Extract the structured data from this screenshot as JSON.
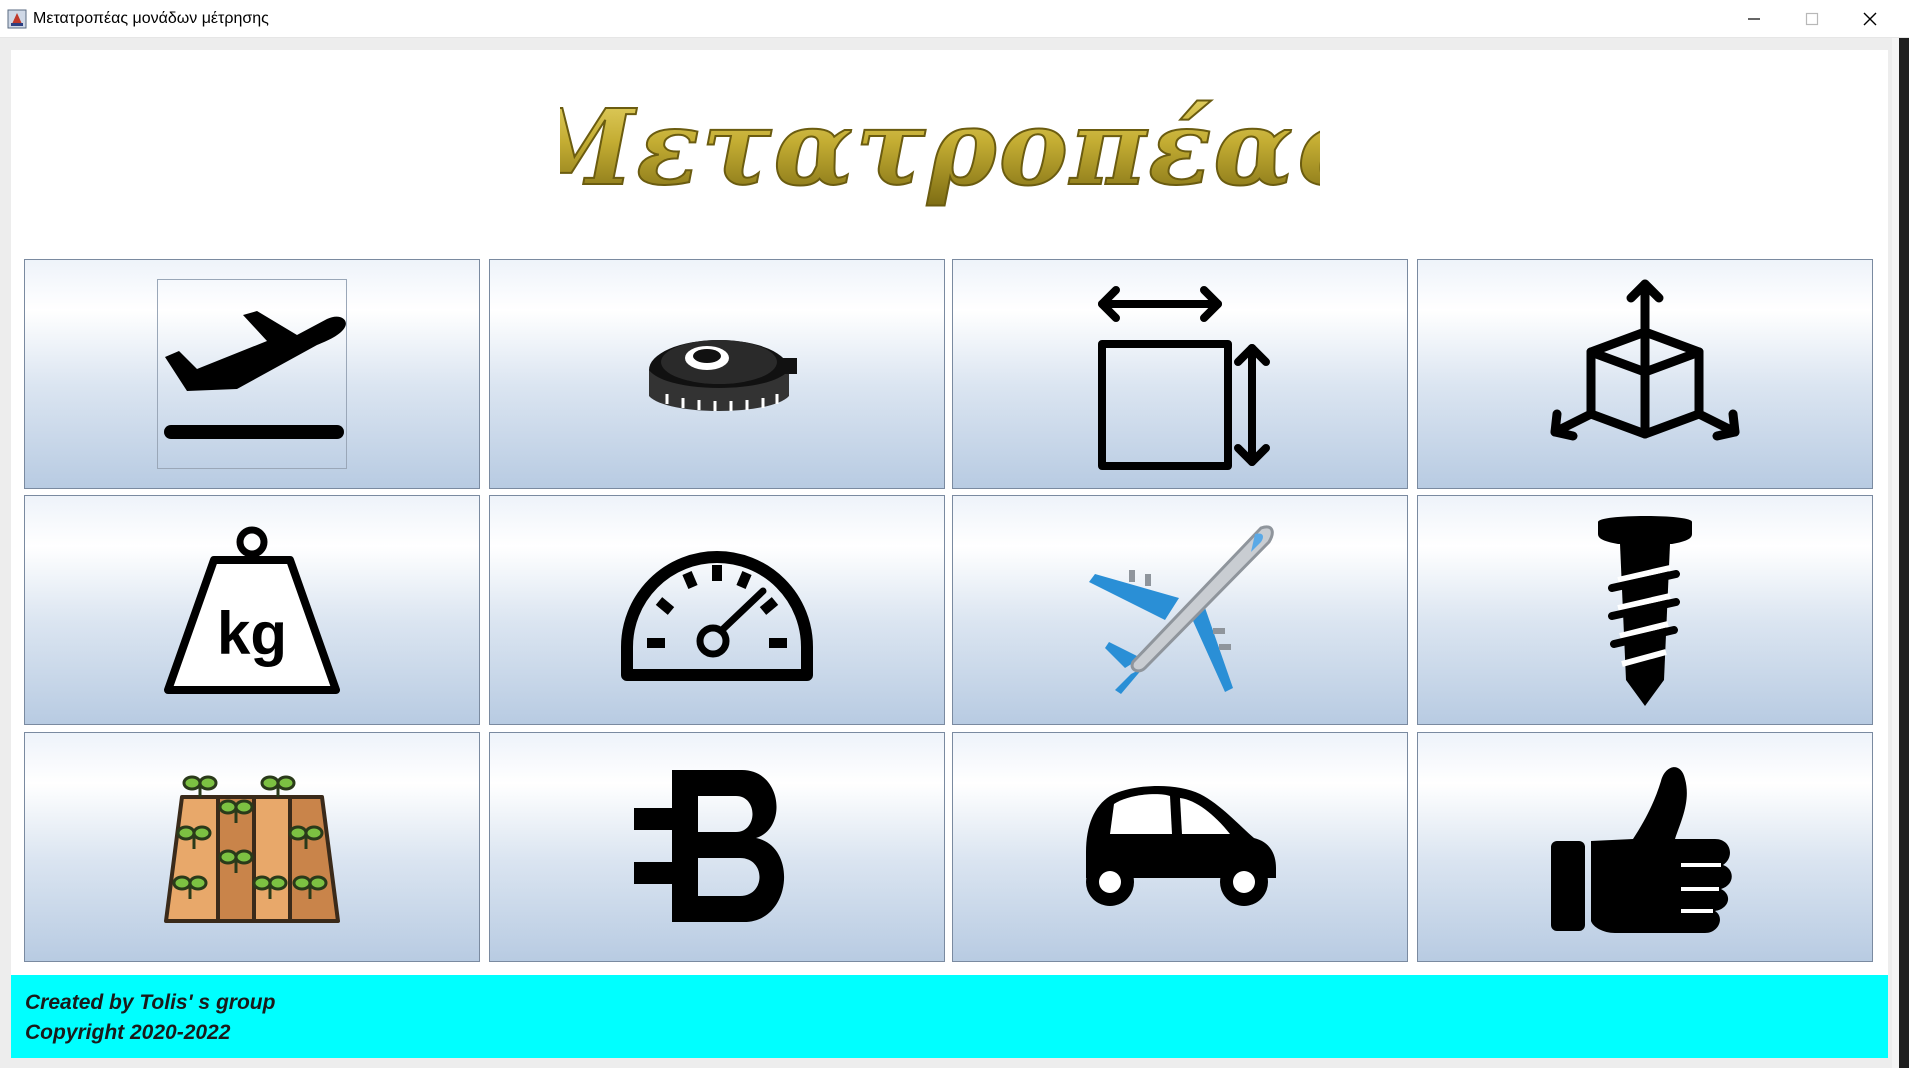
{
  "window": {
    "title": "Μετατροπέας μονάδων μέτρησης",
    "controls": [
      "minimize",
      "maximize",
      "close"
    ]
  },
  "header": {
    "title": "Μετατροπέας",
    "title_color": "#b59d2a"
  },
  "tiles": [
    {
      "icon": "airplane-takeoff-icon"
    },
    {
      "icon": "tape-measure-icon"
    },
    {
      "icon": "area-dimensions-icon"
    },
    {
      "icon": "volume-cube-icon"
    },
    {
      "icon": "weight-kg-icon",
      "icon_text": "kg"
    },
    {
      "icon": "speedometer-icon"
    },
    {
      "icon": "airplane-icon"
    },
    {
      "icon": "screw-icon"
    },
    {
      "icon": "farmland-icon"
    },
    {
      "icon": "bitcoin-b-icon"
    },
    {
      "icon": "car-icon"
    },
    {
      "icon": "thumbs-up-icon"
    }
  ],
  "footer": {
    "line1": "Created by Tolis' s group",
    "line2": "Copyright 2020-2022",
    "background": "#00ffff"
  }
}
